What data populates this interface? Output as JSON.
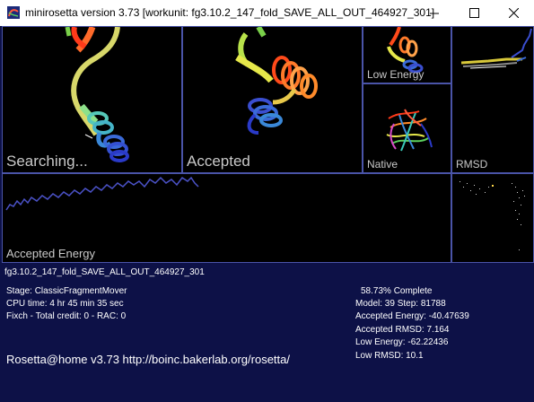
{
  "window": {
    "title": "minirosetta version 3.73 [workunit: fg3.10.2_147_fold_SAVE_ALL_OUT_464927_301]",
    "icon": "rosetta-app-icon",
    "controls": [
      "minimize-icon",
      "maximize-icon",
      "close-icon"
    ]
  },
  "panels": {
    "searching": "Searching...",
    "accepted": "Accepted",
    "low_energy": "Low Energy",
    "native": "Native",
    "rmsd": "RMSD",
    "accepted_energy": "Accepted Energy"
  },
  "info": {
    "workunit": "fg3.10.2_147_fold_SAVE_ALL_OUT_464927_301",
    "stage": "Stage: ClassicFragmentMover",
    "cpu_time": "CPU time: 4 hr 45 min 35 sec",
    "credit": "Fixch - Total credit: 0 - RAC: 0",
    "homepage": "Rosetta@home v3.73 http://boinc.bakerlab.org/rosetta/",
    "complete": "58.73% Complete",
    "model_step": "Model: 39  Step: 81788",
    "accepted_energy": "Accepted Energy: -40.47639",
    "accepted_rmsd": "Accepted RMSD:  7.164",
    "low_energy": "Low Energy: -62.22436",
    "low_rmsd": "Low RMSD:  10.1"
  },
  "colors": {
    "background": "#0d1147",
    "panel_border": "#4a54a8",
    "label": "#c9c9c9",
    "energy_line": "#4b52c8"
  }
}
